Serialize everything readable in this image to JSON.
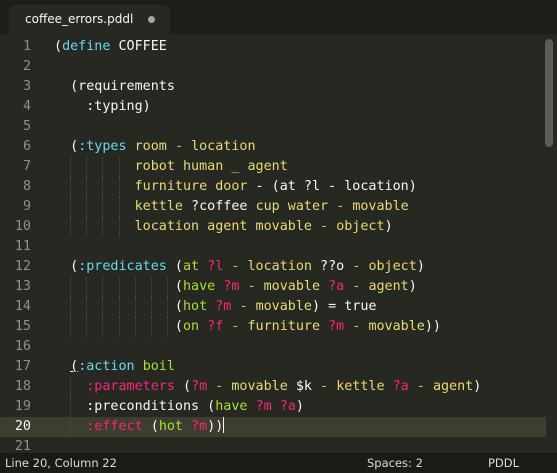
{
  "tab": {
    "title": "coffee_errors.pddl"
  },
  "editor": {
    "current_line": 20,
    "lines": [
      {
        "n": "1",
        "t": [
          [
            "p",
            "("
          ],
          [
            "k",
            "define"
          ],
          [
            "p",
            " COFFEE"
          ]
        ]
      },
      {
        "n": "2",
        "t": []
      },
      {
        "n": "3",
        "t": [
          [
            "p",
            "  (requirements"
          ]
        ]
      },
      {
        "n": "4",
        "t": [
          [
            "p",
            "    :typing)"
          ]
        ]
      },
      {
        "n": "5",
        "t": []
      },
      {
        "n": "6",
        "t": [
          [
            "p",
            "  ("
          ],
          [
            "k",
            ":types"
          ],
          [
            "p",
            " "
          ],
          [
            "y",
            "room"
          ],
          [
            "p",
            " "
          ],
          [
            "g",
            "-"
          ],
          [
            "p",
            " "
          ],
          [
            "y",
            "location"
          ]
        ]
      },
      {
        "n": "7",
        "t": [
          [
            "p",
            "          "
          ],
          [
            "y",
            "robot human _ agent"
          ]
        ]
      },
      {
        "n": "8",
        "t": [
          [
            "p",
            "          "
          ],
          [
            "y",
            "furniture door"
          ],
          [
            "p",
            " - (at ?l - location)"
          ]
        ]
      },
      {
        "n": "9",
        "t": [
          [
            "p",
            "          "
          ],
          [
            "y",
            "kettle"
          ],
          [
            "p",
            " ?coffee "
          ],
          [
            "y",
            "cup water"
          ],
          [
            "p",
            " "
          ],
          [
            "g",
            "-"
          ],
          [
            "p",
            " "
          ],
          [
            "y",
            "movable"
          ]
        ]
      },
      {
        "n": "10",
        "t": [
          [
            "p",
            "          "
          ],
          [
            "y",
            "location agent movable"
          ],
          [
            "p",
            " "
          ],
          [
            "g",
            "-"
          ],
          [
            "p",
            " "
          ],
          [
            "y",
            "object"
          ],
          [
            "p",
            ")"
          ]
        ]
      },
      {
        "n": "11",
        "t": []
      },
      {
        "n": "12",
        "t": [
          [
            "p",
            "  ("
          ],
          [
            "k",
            ":predicates"
          ],
          [
            "p",
            " ("
          ],
          [
            "g",
            "at"
          ],
          [
            "p",
            " "
          ],
          [
            "m",
            "?l"
          ],
          [
            "p",
            " "
          ],
          [
            "g",
            "-"
          ],
          [
            "p",
            " "
          ],
          [
            "y",
            "location"
          ],
          [
            "p",
            " ??o "
          ],
          [
            "g",
            "-"
          ],
          [
            "p",
            " "
          ],
          [
            "y",
            "object"
          ],
          [
            "p",
            ")"
          ]
        ]
      },
      {
        "n": "13",
        "t": [
          [
            "p",
            "               ("
          ],
          [
            "g",
            "have"
          ],
          [
            "p",
            " "
          ],
          [
            "m",
            "?m"
          ],
          [
            "p",
            " "
          ],
          [
            "g",
            "-"
          ],
          [
            "p",
            " "
          ],
          [
            "y",
            "movable"
          ],
          [
            "p",
            " "
          ],
          [
            "m",
            "?a"
          ],
          [
            "p",
            " "
          ],
          [
            "g",
            "-"
          ],
          [
            "p",
            " "
          ],
          [
            "y",
            "agent"
          ],
          [
            "p",
            ")"
          ]
        ]
      },
      {
        "n": "14",
        "t": [
          [
            "p",
            "               ("
          ],
          [
            "g",
            "hot"
          ],
          [
            "p",
            " "
          ],
          [
            "m",
            "?m"
          ],
          [
            "p",
            " "
          ],
          [
            "g",
            "-"
          ],
          [
            "p",
            " "
          ],
          [
            "y",
            "movable"
          ],
          [
            "p",
            ") = true"
          ]
        ]
      },
      {
        "n": "15",
        "t": [
          [
            "p",
            "               ("
          ],
          [
            "g",
            "on"
          ],
          [
            "p",
            " "
          ],
          [
            "m",
            "?f"
          ],
          [
            "p",
            " "
          ],
          [
            "g",
            "-"
          ],
          [
            "p",
            " "
          ],
          [
            "y",
            "furniture"
          ],
          [
            "p",
            " "
          ],
          [
            "m",
            "?m"
          ],
          [
            "p",
            " "
          ],
          [
            "g",
            "-"
          ],
          [
            "p",
            " "
          ],
          [
            "y",
            "movable"
          ],
          [
            "p",
            "))"
          ]
        ]
      },
      {
        "n": "16",
        "t": []
      },
      {
        "n": "17",
        "t": [
          [
            "p",
            "  "
          ],
          [
            "ul",
            "("
          ],
          [
            "k",
            ":action"
          ],
          [
            "p",
            " "
          ],
          [
            "g",
            "boil"
          ]
        ]
      },
      {
        "n": "18",
        "t": [
          [
            "p",
            "    "
          ],
          [
            "m",
            ":parameters"
          ],
          [
            "p",
            " ("
          ],
          [
            "m",
            "?m"
          ],
          [
            "p",
            " "
          ],
          [
            "g",
            "-"
          ],
          [
            "p",
            " "
          ],
          [
            "y",
            "movable"
          ],
          [
            "p",
            " $k "
          ],
          [
            "g",
            "-"
          ],
          [
            "p",
            " "
          ],
          [
            "y",
            "kettle"
          ],
          [
            "p",
            " "
          ],
          [
            "m",
            "?a"
          ],
          [
            "p",
            " "
          ],
          [
            "g",
            "-"
          ],
          [
            "p",
            " "
          ],
          [
            "y",
            "agent"
          ],
          [
            "p",
            ")"
          ]
        ]
      },
      {
        "n": "19",
        "t": [
          [
            "p",
            "    :preconditions ("
          ],
          [
            "g",
            "have"
          ],
          [
            "p",
            " "
          ],
          [
            "m",
            "?m ?a"
          ],
          [
            "p",
            ")"
          ]
        ]
      },
      {
        "n": "20",
        "t": [
          [
            "p",
            "    "
          ],
          [
            "m",
            ":effect"
          ],
          [
            "p",
            " ("
          ],
          [
            "g",
            "hot"
          ],
          [
            "p",
            " "
          ],
          [
            "m",
            "?m"
          ],
          [
            "p",
            "))"
          ]
        ]
      },
      {
        "n": "21",
        "t": []
      }
    ]
  },
  "statusbar": {
    "position": "Line 20, Column 22",
    "indent": "Spaces: 2",
    "syntax": "PDDL"
  },
  "theme": {
    "background": "#272822",
    "keyword": "#66d9ef",
    "string": "#e6db74",
    "function": "#a6e22e",
    "variable": "#f92672"
  }
}
